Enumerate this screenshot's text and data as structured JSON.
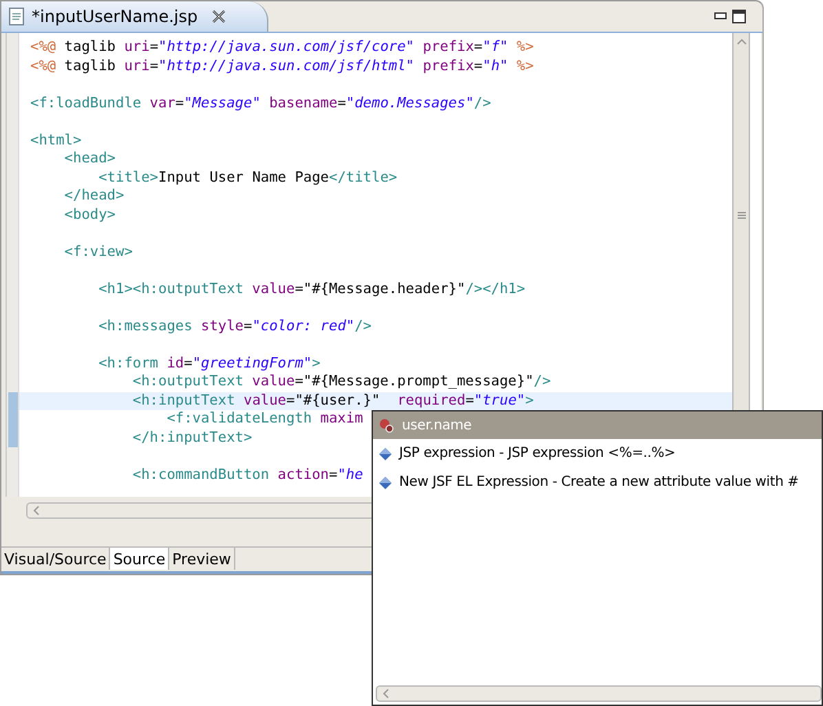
{
  "editor_tab": {
    "title": "*inputUserName.jsp"
  },
  "code_lines": [
    {
      "kind": "code",
      "current": false,
      "tokens": [
        {
          "kind": "directive",
          "text": "<%@"
        },
        {
          "kind": "text",
          "text": " taglib"
        },
        {
          "kind": "attr",
          "text": " uri"
        },
        {
          "kind": "text",
          "text": "="
        },
        {
          "kind": "value",
          "text": "\"http://java.sun.com/jsf/core\""
        },
        {
          "kind": "attr",
          "text": " prefix"
        },
        {
          "kind": "text",
          "text": "="
        },
        {
          "kind": "value",
          "text": "\"f\""
        },
        {
          "kind": "directive",
          "text": " %>"
        }
      ]
    },
    {
      "kind": "code",
      "current": false,
      "tokens": [
        {
          "kind": "directive",
          "text": "<%@"
        },
        {
          "kind": "text",
          "text": " taglib"
        },
        {
          "kind": "attr",
          "text": " uri"
        },
        {
          "kind": "text",
          "text": "="
        },
        {
          "kind": "value",
          "text": "\"http://java.sun.com/jsf/html\""
        },
        {
          "kind": "attr",
          "text": " prefix"
        },
        {
          "kind": "text",
          "text": "="
        },
        {
          "kind": "value",
          "text": "\"h\""
        },
        {
          "kind": "directive",
          "text": " %>"
        }
      ]
    },
    {
      "kind": "blank"
    },
    {
      "kind": "code",
      "current": false,
      "tokens": [
        {
          "kind": "tag",
          "text": "<f:loadBundle"
        },
        {
          "kind": "attr",
          "text": " var"
        },
        {
          "kind": "text",
          "text": "="
        },
        {
          "kind": "value",
          "text": "\"Message\""
        },
        {
          "kind": "attr",
          "text": " basename"
        },
        {
          "kind": "text",
          "text": "="
        },
        {
          "kind": "value",
          "text": "\"demo.Messages\""
        },
        {
          "kind": "tag",
          "text": "/>"
        }
      ]
    },
    {
      "kind": "blank"
    },
    {
      "kind": "code",
      "current": false,
      "tokens": [
        {
          "kind": "tag",
          "text": "<html>"
        }
      ]
    },
    {
      "kind": "code",
      "current": false,
      "tokens": [
        {
          "kind": "tag",
          "text": "    <head>"
        }
      ]
    },
    {
      "kind": "code",
      "current": false,
      "tokens": [
        {
          "kind": "tag",
          "text": "        <title>"
        },
        {
          "kind": "text",
          "text": "Input User Name Page"
        },
        {
          "kind": "tag",
          "text": "</title>"
        }
      ]
    },
    {
      "kind": "code",
      "current": false,
      "tokens": [
        {
          "kind": "tag",
          "text": "    </head>"
        }
      ]
    },
    {
      "kind": "code",
      "current": false,
      "tokens": [
        {
          "kind": "tag",
          "text": "    <body>"
        }
      ]
    },
    {
      "kind": "blank"
    },
    {
      "kind": "code",
      "current": false,
      "tokens": [
        {
          "kind": "tag",
          "text": "    <f:view>"
        }
      ]
    },
    {
      "kind": "blank"
    },
    {
      "kind": "code",
      "current": false,
      "tokens": [
        {
          "kind": "tag",
          "text": "        <h1><h:outputText"
        },
        {
          "kind": "attr",
          "text": " value"
        },
        {
          "kind": "text",
          "text": "=\"#{Message.header}\""
        },
        {
          "kind": "tag",
          "text": "/></h1>"
        }
      ]
    },
    {
      "kind": "blank"
    },
    {
      "kind": "code",
      "current": false,
      "tokens": [
        {
          "kind": "tag",
          "text": "        <h:messages"
        },
        {
          "kind": "attr",
          "text": " style"
        },
        {
          "kind": "text",
          "text": "="
        },
        {
          "kind": "value",
          "text": "\"color: red\""
        },
        {
          "kind": "tag",
          "text": "/>"
        }
      ]
    },
    {
      "kind": "blank"
    },
    {
      "kind": "code",
      "current": false,
      "tokens": [
        {
          "kind": "tag",
          "text": "        <h:form"
        },
        {
          "kind": "attr",
          "text": " id"
        },
        {
          "kind": "text",
          "text": "="
        },
        {
          "kind": "value",
          "text": "\"greetingForm\""
        },
        {
          "kind": "tag",
          "text": ">"
        }
      ]
    },
    {
      "kind": "code",
      "current": false,
      "tokens": [
        {
          "kind": "tag",
          "text": "            <h:outputText"
        },
        {
          "kind": "attr",
          "text": " value"
        },
        {
          "kind": "text",
          "text": "=\"#{Message.prompt_message}\""
        },
        {
          "kind": "tag",
          "text": "/>"
        }
      ]
    },
    {
      "kind": "code",
      "current": true,
      "tokens": [
        {
          "kind": "tag",
          "text": "            <h:inputText"
        },
        {
          "kind": "attr",
          "text": " value"
        },
        {
          "kind": "text",
          "text": "=\"#{user.}\""
        },
        {
          "kind": "attr",
          "text": "  required"
        },
        {
          "kind": "text",
          "text": "="
        },
        {
          "kind": "value",
          "text": "\"true\""
        },
        {
          "kind": "tag",
          "text": ">"
        }
      ]
    },
    {
      "kind": "code",
      "current": false,
      "tokens": [
        {
          "kind": "tag",
          "text": "                <f:validateLength"
        },
        {
          "kind": "attr",
          "text": " maxim"
        }
      ]
    },
    {
      "kind": "code",
      "current": false,
      "tokens": [
        {
          "kind": "tag",
          "text": "            </h:inputText>"
        }
      ]
    },
    {
      "kind": "blank"
    },
    {
      "kind": "code",
      "current": false,
      "tokens": [
        {
          "kind": "tag",
          "text": "            <h:commandButton"
        },
        {
          "kind": "attr",
          "text": " action"
        },
        {
          "kind": "text",
          "text": "="
        },
        {
          "kind": "value",
          "text": "\"he"
        }
      ]
    }
  ],
  "bottom_tabs": [
    {
      "label": "Visual/Source",
      "selected": false
    },
    {
      "label": "Source",
      "selected": true
    },
    {
      "label": "Preview",
      "selected": false
    }
  ],
  "completion_popup": {
    "items": [
      {
        "kind": "property",
        "label": "user.name",
        "selected": true
      },
      {
        "kind": "template",
        "label": "JSP expression - JSP expression <%=..%>",
        "selected": false
      },
      {
        "kind": "template",
        "label": "New JSF EL Expression - Create a new attribute value with #",
        "selected": false
      }
    ]
  }
}
